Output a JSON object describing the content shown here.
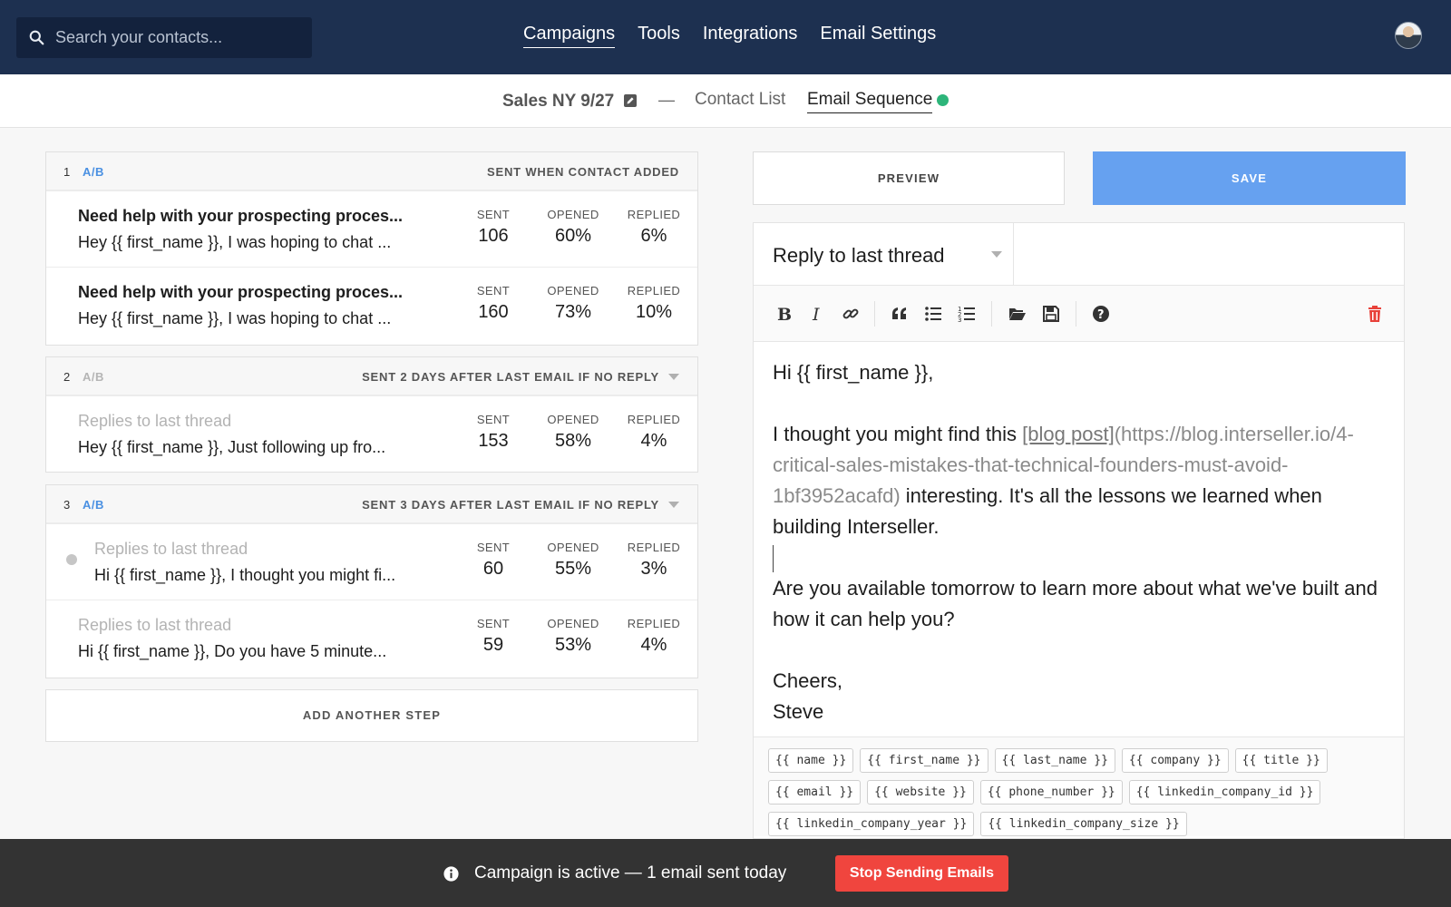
{
  "search": {
    "placeholder": "Search your contacts..."
  },
  "nav": {
    "items": [
      {
        "label": "Campaigns",
        "active": true
      },
      {
        "label": "Tools",
        "active": false
      },
      {
        "label": "Integrations",
        "active": false
      },
      {
        "label": "Email Settings",
        "active": false
      }
    ]
  },
  "campaign": {
    "name": "Sales NY 9/27",
    "separator": "—",
    "tabs": [
      {
        "label": "Contact List",
        "active": false
      },
      {
        "label": "Email Sequence",
        "active": true
      }
    ],
    "status_color": "#2db57a"
  },
  "steps": [
    {
      "number": "1",
      "ab": "A/B",
      "ab_enabled": true,
      "trigger": "SENT WHEN CONTACT ADDED",
      "variants": [
        {
          "subject": "Need help with your prospecting proces...",
          "body": "Hey {{ first_name }}, I was hoping to chat ...",
          "sent": "106",
          "opened": "60%",
          "replied": "6%"
        },
        {
          "subject": "Need help with your prospecting proces...",
          "body": "Hey {{ first_name }}, I was hoping to chat ...",
          "sent": "160",
          "opened": "73%",
          "replied": "10%"
        }
      ]
    },
    {
      "number": "2",
      "ab": "A/B",
      "ab_enabled": false,
      "trigger": "SENT 2 DAYS AFTER LAST EMAIL IF NO REPLY",
      "variants": [
        {
          "subject": "Replies to last thread",
          "body": "Hey {{ first_name }}, Just following up fro...",
          "sent": "153",
          "opened": "58%",
          "replied": "4%"
        }
      ]
    },
    {
      "number": "3",
      "ab": "A/B",
      "ab_enabled": true,
      "trigger": "SENT 3 DAYS AFTER LAST EMAIL IF NO REPLY",
      "variants": [
        {
          "subject": "Replies to last thread",
          "body": "Hi {{ first_name }}, I thought you might fi...",
          "sent": "60",
          "opened": "55%",
          "replied": "3%"
        },
        {
          "subject": "Replies to last thread",
          "body": "Hi {{ first_name }}, Do you have 5 minute...",
          "sent": "59",
          "opened": "53%",
          "replied": "4%"
        }
      ]
    }
  ],
  "stat_labels": {
    "sent": "SENT",
    "opened": "OPENED",
    "replied": "REPLIED"
  },
  "add_step_label": "ADD ANOTHER STEP",
  "editor": {
    "preview_label": "PREVIEW",
    "save_label": "SAVE",
    "thread_option": "Reply to last thread",
    "toolbar_icons": [
      "bold-icon",
      "italic-icon",
      "link-icon",
      "quote-icon",
      "bullet-list-icon",
      "numbered-list-icon",
      "folder-open-icon",
      "save-icon",
      "help-icon",
      "trash-icon"
    ],
    "body": {
      "greeting": "Hi {{ first_name }},",
      "p1_before": "I thought you might find this ",
      "p1_link_text": "[blog post]",
      "p1_url": "(https://blog.interseller.io/4-critical-sales-mistakes-that-technical-founders-must-avoid-1bf3952acafd)",
      "p1_after": " interesting. It's all the lessons we learned when building Interseller.",
      "p2": "Are you available tomorrow to learn more about what we've built and how it can help you?",
      "closing": "Cheers,",
      "signature": "Steve"
    },
    "merge_tags": [
      "{{ name }}",
      "{{ first_name }}",
      "{{ last_name }}",
      "{{ company }}",
      "{{ title }}",
      "{{ email }}",
      "{{ website }}",
      "{{ phone_number }}",
      "{{ linkedin_company_id }}",
      "{{ linkedin_company_year }}",
      "{{ linkedin_company_size }}"
    ]
  },
  "status_bar": {
    "message": "Campaign is active — 1 email sent today",
    "stop_label": "Stop Sending Emails"
  },
  "colors": {
    "nav_bg": "#1d3050",
    "save_blue": "#66a1f0",
    "ab_blue": "#4a90e2",
    "stop_red": "#f0453e",
    "delete_red": "#e8413a"
  }
}
